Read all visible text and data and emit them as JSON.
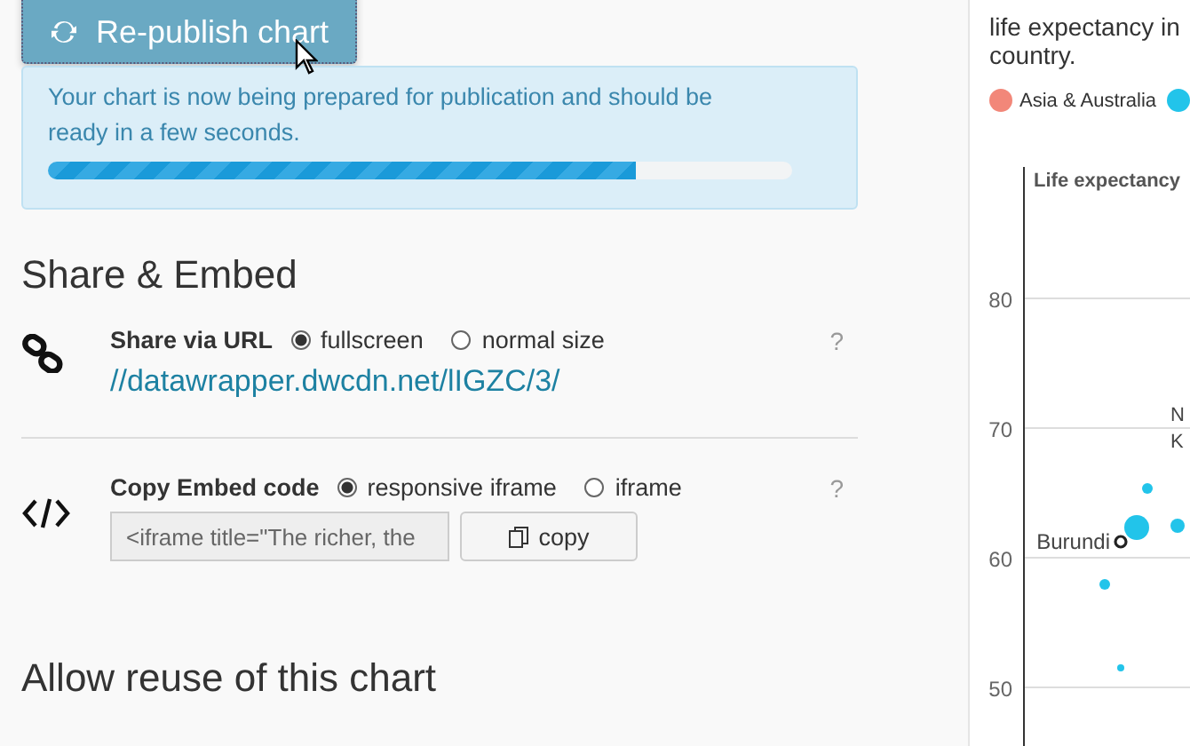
{
  "publish_button": {
    "label": "Re-publish chart"
  },
  "publish_status": {
    "message": "Your chart is now being prepared for publication and should be ready in a few seconds.",
    "level": 0.79
  },
  "share_embed": {
    "heading": "Share & Embed",
    "share_url": {
      "label": "Share via URL",
      "options": [
        {
          "label": "fullscreen",
          "selected": true
        },
        {
          "label": "normal size",
          "selected": false
        }
      ],
      "url": "//datawrapper.dwcdn.net/lIGZC/3/",
      "help": "?"
    },
    "embed": {
      "label": "Copy Embed code",
      "options": [
        {
          "label": "responsive iframe",
          "selected": true
        },
        {
          "label": "iframe",
          "selected": false
        }
      ],
      "code": "<iframe title=\"The richer, the",
      "copy_button": "copy",
      "help": "?"
    }
  },
  "reuse": {
    "heading": "Allow reuse of this chart"
  },
  "preview": {
    "description": [
      "life expectancy in",
      "country."
    ],
    "legend": [
      {
        "label": "Asia & Australia",
        "color": "#f28779"
      },
      {
        "color": "#22c4ea"
      }
    ],
    "y_axis_title": "Life expectancy",
    "yticks": [
      "80",
      "70",
      "60",
      "50"
    ],
    "point_labels": [
      "N",
      "K",
      "Burundi"
    ]
  }
}
